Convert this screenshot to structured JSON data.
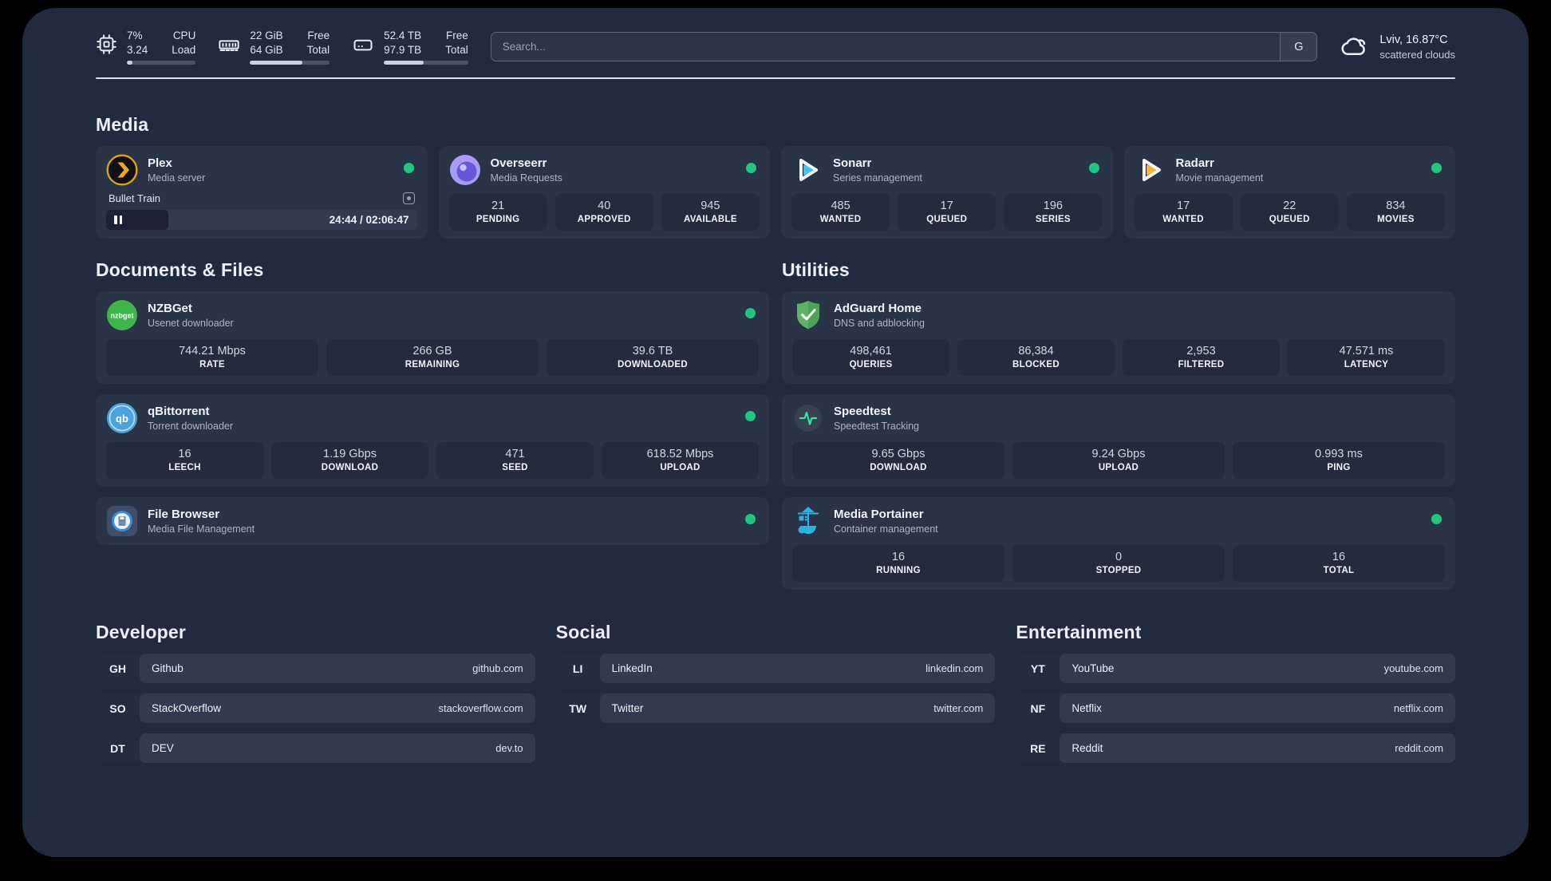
{
  "header": {
    "stats": [
      {
        "icon": "cpu-chip-icon",
        "values": [
          "7%",
          "3.24"
        ],
        "labels": [
          "CPU",
          "Load"
        ],
        "progress_pct": 8
      },
      {
        "icon": "memory-icon",
        "values": [
          "22 GiB",
          "64 GiB"
        ],
        "labels": [
          "Free",
          "Total"
        ],
        "progress_pct": 66
      },
      {
        "icon": "hard-drive-icon",
        "values": [
          "52.4 TB",
          "97.9 TB"
        ],
        "labels": [
          "Free",
          "Total"
        ],
        "progress_pct": 47
      }
    ],
    "search": {
      "placeholder": "Search...",
      "button_label": "G"
    },
    "weather": {
      "icon": "cloud-icon",
      "location_temp": "Lviv, 16.87°C",
      "condition": "scattered clouds"
    }
  },
  "sections": {
    "media": {
      "title": "Media",
      "apps": [
        {
          "name": "Plex",
          "subtitle": "Media server",
          "icon": "plex-icon",
          "online": true,
          "player": {
            "track": "Bullet Train",
            "time": "24:44 / 02:06:47",
            "progress_pct": 20
          }
        },
        {
          "name": "Overseerr",
          "subtitle": "Media Requests",
          "icon": "overseerr-icon",
          "online": true,
          "stats": [
            {
              "value": "21",
              "label": "PENDING"
            },
            {
              "value": "40",
              "label": "APPROVED"
            },
            {
              "value": "945",
              "label": "AVAILABLE"
            }
          ]
        },
        {
          "name": "Sonarr",
          "subtitle": "Series management",
          "icon": "sonarr-icon",
          "online": true,
          "stats": [
            {
              "value": "485",
              "label": "WANTED"
            },
            {
              "value": "17",
              "label": "QUEUED"
            },
            {
              "value": "196",
              "label": "SERIES"
            }
          ]
        },
        {
          "name": "Radarr",
          "subtitle": "Movie management",
          "icon": "radarr-icon",
          "online": true,
          "stats": [
            {
              "value": "17",
              "label": "WANTED"
            },
            {
              "value": "22",
              "label": "QUEUED"
            },
            {
              "value": "834",
              "label": "MOVIES"
            }
          ]
        }
      ]
    },
    "documents": {
      "title": "Documents & Files",
      "apps": [
        {
          "name": "NZBGet",
          "subtitle": "Usenet downloader",
          "icon": "nzbget-icon",
          "online": true,
          "stats": [
            {
              "value": "744.21 Mbps",
              "label": "RATE"
            },
            {
              "value": "266 GB",
              "label": "REMAINING"
            },
            {
              "value": "39.6 TB",
              "label": "DOWNLOADED"
            }
          ]
        },
        {
          "name": "qBittorrent",
          "subtitle": "Torrent downloader",
          "icon": "qbittorrent-icon",
          "online": true,
          "stats": [
            {
              "value": "16",
              "label": "LEECH"
            },
            {
              "value": "1.19 Gbps",
              "label": "DOWNLOAD"
            },
            {
              "value": "471",
              "label": "SEED"
            },
            {
              "value": "618.52 Mbps",
              "label": "UPLOAD"
            }
          ]
        },
        {
          "name": "File Browser",
          "subtitle": "Media File Management",
          "icon": "filebrowser-icon",
          "online": true
        }
      ]
    },
    "utilities": {
      "title": "Utilities",
      "apps": [
        {
          "name": "AdGuard Home",
          "subtitle": "DNS and adblocking",
          "icon": "adguard-icon",
          "online": false,
          "stats": [
            {
              "value": "498,461",
              "label": "QUERIES"
            },
            {
              "value": "86,384",
              "label": "BLOCKED"
            },
            {
              "value": "2,953",
              "label": "FILTERED"
            },
            {
              "value": "47.571 ms",
              "label": "LATENCY"
            }
          ]
        },
        {
          "name": "Speedtest",
          "subtitle": "Speedtest Tracking",
          "icon": "speedtest-icon",
          "online": false,
          "stats": [
            {
              "value": "9.65 Gbps",
              "label": "DOWNLOAD"
            },
            {
              "value": "9.24 Gbps",
              "label": "UPLOAD"
            },
            {
              "value": "0.993 ms",
              "label": "PING"
            }
          ]
        },
        {
          "name": "Media Portainer",
          "subtitle": "Container management",
          "icon": "portainer-icon",
          "online": true,
          "stats": [
            {
              "value": "16",
              "label": "RUNNING"
            },
            {
              "value": "0",
              "label": "STOPPED"
            },
            {
              "value": "16",
              "label": "TOTAL"
            }
          ]
        }
      ]
    },
    "developer": {
      "title": "Developer",
      "links": [
        {
          "abbr": "GH",
          "name": "Github",
          "url": "github.com"
        },
        {
          "abbr": "SO",
          "name": "StackOverflow",
          "url": "stackoverflow.com"
        },
        {
          "abbr": "DT",
          "name": "DEV",
          "url": "dev.to"
        }
      ]
    },
    "social": {
      "title": "Social",
      "links": [
        {
          "abbr": "LI",
          "name": "LinkedIn",
          "url": "linkedin.com"
        },
        {
          "abbr": "TW",
          "name": "Twitter",
          "url": "twitter.com"
        }
      ]
    },
    "entertainment": {
      "title": "Entertainment",
      "links": [
        {
          "abbr": "YT",
          "name": "YouTube",
          "url": "youtube.com"
        },
        {
          "abbr": "NF",
          "name": "Netflix",
          "url": "netflix.com"
        },
        {
          "abbr": "RE",
          "name": "Reddit",
          "url": "reddit.com"
        }
      ]
    }
  },
  "colors": {
    "status_online": "#1fc77d",
    "plex_accent": "#f0a52a",
    "sonarr_accent": "#38c6f4",
    "radarr_accent": "#fcb42c",
    "nzbget_accent": "#3db549",
    "qbittorrent_accent": "#4ba3dd",
    "adguard_accent": "#5fb363",
    "portainer_accent": "#29b2e4",
    "speedtest_pulse": "#2ee6a8"
  }
}
